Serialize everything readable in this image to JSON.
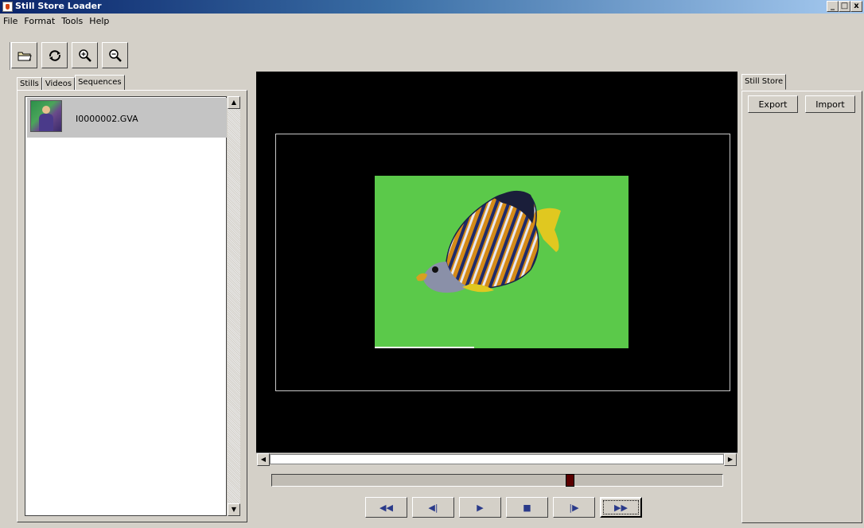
{
  "window": {
    "title": "Still Store Loader",
    "controls": [
      "_",
      "□",
      "x"
    ]
  },
  "menu": [
    "File",
    "Format",
    "Tools",
    "Help"
  ],
  "toolbar": [
    {
      "name": "open",
      "icon": "folder-icon"
    },
    {
      "name": "refresh",
      "icon": "refresh-icon"
    },
    {
      "name": "zoom-in",
      "icon": "zoom-in-icon"
    },
    {
      "name": "zoom-out",
      "icon": "zoom-out-icon"
    }
  ],
  "left_tabs": [
    "Stills",
    "Videos",
    "Sequences"
  ],
  "left_active_tab": "Sequences",
  "list_items": [
    {
      "name": "I0000002.GVA",
      "selected": true
    }
  ],
  "timeline": {
    "position": 0.66
  },
  "transport": [
    {
      "name": "rewind",
      "glyph": "◀◀"
    },
    {
      "name": "step-back",
      "glyph": "◀|"
    },
    {
      "name": "play",
      "glyph": "▶"
    },
    {
      "name": "stop",
      "glyph": "■"
    },
    {
      "name": "step-forward",
      "glyph": "|▶"
    },
    {
      "name": "fast-forward",
      "glyph": "▶▶"
    }
  ],
  "right_tab": "Still Store",
  "right_buttons": {
    "export": "Export",
    "import": "Import"
  }
}
